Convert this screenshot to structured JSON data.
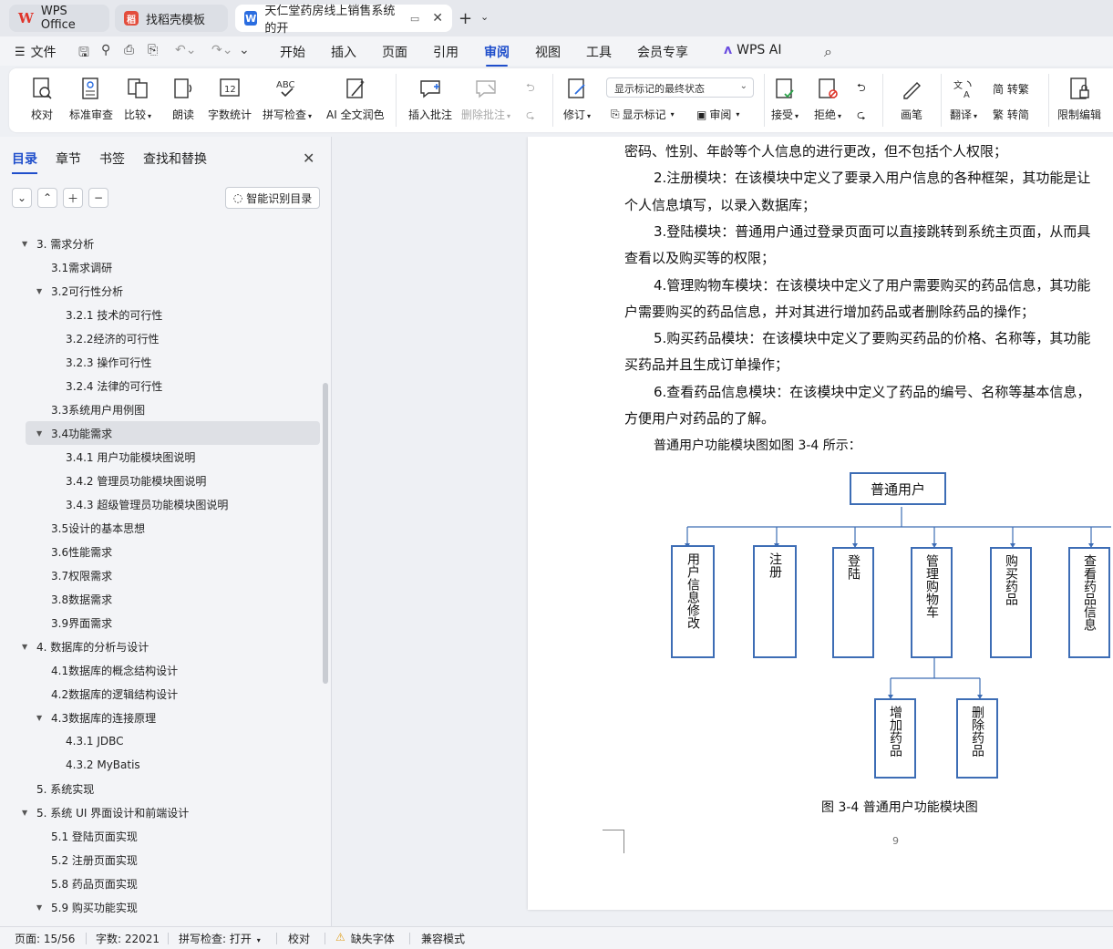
{
  "tabs": [
    {
      "label": "WPS Office"
    },
    {
      "label": "找稻壳模板"
    },
    {
      "label": "天仁堂药房线上销售系统的开"
    }
  ],
  "menu": {
    "file_label": "文件",
    "tabs": [
      "开始",
      "插入",
      "页面",
      "引用",
      "审阅",
      "视图",
      "工具",
      "会员专享",
      "WPS AI"
    ],
    "active_tab": "审阅"
  },
  "ribbon": {
    "proofread": "校对",
    "standard_review": "标准审查",
    "compare": "比较",
    "read_aloud": "朗读",
    "word_count": "字数统计",
    "spell_check": "拼写检查",
    "ai_polish": "AI 全文润色",
    "insert_comment": "插入批注",
    "delete_comment": "删除批注",
    "revise": "修订",
    "markup_select": "显示标记的最终状态",
    "show_markup": "显示标记",
    "review": "审阅",
    "accept": "接受",
    "reject": "拒绝",
    "pen": "画笔",
    "translate": "翻译",
    "to_traditional": "简 转繁",
    "to_simplified": "繁 转简",
    "restrict_edit": "限制编辑"
  },
  "sidepanel": {
    "tabs": [
      "目录",
      "章节",
      "书签",
      "查找和替换"
    ],
    "active_tab": "目录",
    "smart_toc": "智能识别目录",
    "toc": [
      {
        "label": "3.  需求分析",
        "level": 1,
        "expanded": true
      },
      {
        "label": "3.1需求调研",
        "level": 2
      },
      {
        "label": "3.2可行性分析",
        "level": 2,
        "expanded": true
      },
      {
        "label": "3.2.1  技术的可行性",
        "level": 3
      },
      {
        "label": "3.2.2经济的可行性",
        "level": 3
      },
      {
        "label": "3.2.3  操作可行性",
        "level": 3
      },
      {
        "label": "3.2.4  法律的可行性",
        "level": 3
      },
      {
        "label": "3.3系统用户用例图",
        "level": 2
      },
      {
        "label": "3.4功能需求",
        "level": 2,
        "expanded": true,
        "selected": true
      },
      {
        "label": "3.4.1  用户功能模块图说明",
        "level": 3
      },
      {
        "label": "3.4.2  管理员功能模块图说明",
        "level": 3
      },
      {
        "label": "3.4.3  超级管理员功能模块图说明",
        "level": 3
      },
      {
        "label": "3.5设计的基本思想",
        "level": 2
      },
      {
        "label": "3.6性能需求",
        "level": 2
      },
      {
        "label": "3.7权限需求",
        "level": 2
      },
      {
        "label": "3.8数据需求",
        "level": 2
      },
      {
        "label": "3.9界面需求",
        "level": 2
      },
      {
        "label": "4.  数据库的分析与设计",
        "level": 1,
        "expanded": true
      },
      {
        "label": "4.1数据库的概念结构设计",
        "level": 2
      },
      {
        "label": "4.2数据库的逻辑结构设计",
        "level": 2
      },
      {
        "label": "4.3数据库的连接原理",
        "level": 2,
        "expanded": true
      },
      {
        "label": "4.3.1 JDBC",
        "level": 3
      },
      {
        "label": "4.3.2 MyBatis",
        "level": 3
      },
      {
        "label": "5.  系统实现",
        "level": 1
      },
      {
        "label": "5.  系统 UI 界面设计和前端设计",
        "level": 1,
        "expanded": true
      },
      {
        "label": "5.1  登陆页面实现",
        "level": 2
      },
      {
        "label": "5.2  注册页面实现",
        "level": 2
      },
      {
        "label": "5.8  药品页面实现",
        "level": 2
      },
      {
        "label": "5.9  购买功能实现",
        "level": 2,
        "expanded": true
      }
    ]
  },
  "document": {
    "paragraphs": [
      {
        "text": "密码、性别、年龄等个人信息的进行更改，但不包括个人权限；",
        "indent": false
      },
      {
        "text": "2.注册模块：在该模块中定义了要录入用户信息的各种框架，其功能是让",
        "indent": true
      },
      {
        "text": "个人信息填写，以录入数据库；",
        "indent": false
      },
      {
        "text": "3.登陆模块：普通用户通过登录页面可以直接跳转到系统主页面，从而具",
        "indent": true
      },
      {
        "text": "查看以及购买等的权限；",
        "indent": false
      },
      {
        "text": "4.管理购物车模块：在该模块中定义了用户需要购买的药品信息，其功能",
        "indent": true
      },
      {
        "text": "户需要购买的药品信息，并对其进行增加药品或者删除药品的操作；",
        "indent": false
      },
      {
        "text": "5.购买药品模块：在该模块中定义了要购买药品的价格、名称等，其功能",
        "indent": true
      },
      {
        "text": "买药品并且生成订单操作；",
        "indent": false
      },
      {
        "text": "6.查看药品信息模块：在该模块中定义了药品的编号、名称等基本信息，",
        "indent": true
      },
      {
        "text": "方便用户对药品的了解。",
        "indent": false
      },
      {
        "text": "普通用户功能模块图如图 3-4 所示：",
        "indent": true
      }
    ],
    "diagram": {
      "root": "普通用户",
      "children": [
        "用户信息修改",
        "注册",
        "登陆",
        "管理购物车",
        "购买药品",
        "查看药品信息"
      ],
      "grandchildren": [
        "增加药品",
        "删除药品"
      ]
    },
    "caption": "图 3-4 普通用户功能模块图",
    "page_number": "9"
  },
  "statusbar": {
    "page": "页面: 15/56",
    "words": "字数: 22021",
    "spell": "拼写检查: 打开",
    "proof": "校对",
    "missing_font": "缺失字体",
    "compat": "兼容模式"
  },
  "colors": {
    "accent": "#1f4ecb",
    "diagram_line": "#3d6db5"
  }
}
